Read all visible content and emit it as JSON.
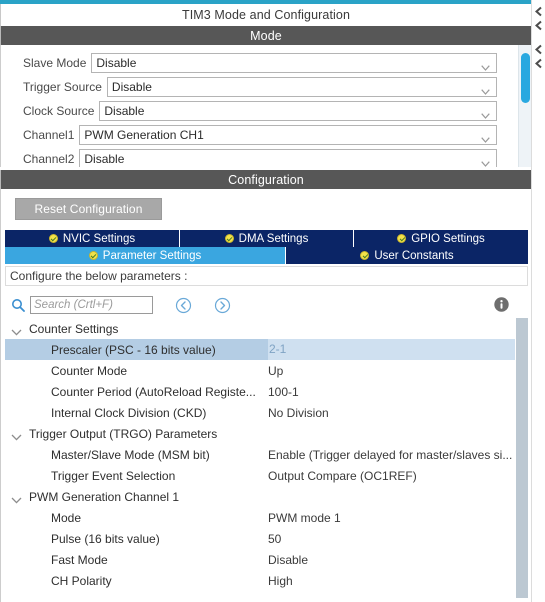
{
  "window": {
    "title": "TIM3 Mode and Configuration",
    "accent_color": "#2aa3c7"
  },
  "mode_section": {
    "band_title": "Mode",
    "fields": [
      {
        "label": "Slave Mode",
        "value": "Disable",
        "icon": "chevron-down-icon"
      },
      {
        "label": "Trigger Source",
        "value": "Disable",
        "icon": "chevron-down-icon"
      },
      {
        "label": "Clock Source",
        "value": "Disable",
        "icon": "chevron-down-icon"
      },
      {
        "label": "Channel1",
        "value": "PWM Generation CH1",
        "icon": "chevron-down-icon"
      },
      {
        "label": "Channel2",
        "value": "Disable",
        "icon": "chevron-down-icon"
      }
    ],
    "scrollbar": {
      "thumb_color": "#29a8e0",
      "track_color": "#eef3f7"
    }
  },
  "configuration_section": {
    "band_title": "Configuration",
    "reset_button": "Reset Configuration",
    "tabs_row1": [
      {
        "label": "NVIC Settings",
        "active": false,
        "icon": "check-badge-icon"
      },
      {
        "label": "DMA Settings",
        "active": false,
        "icon": "check-badge-icon"
      },
      {
        "label": "GPIO Settings",
        "active": false,
        "icon": "check-badge-icon"
      }
    ],
    "tabs_row2": [
      {
        "label": "Parameter Settings",
        "active": true,
        "icon": "check-badge-icon"
      },
      {
        "label": "User Constants",
        "active": false,
        "icon": "check-badge-icon"
      }
    ],
    "tab_colors": {
      "inactive_bg": "#0b2566",
      "active_bg": "#3aa6e0",
      "badge": "#f2e24a"
    },
    "configure_hint": "Configure the below parameters :",
    "search": {
      "placeholder": "Search (Crtl+F)",
      "value": "",
      "search_icon": "search-icon",
      "prev_icon": "circle-chevron-left-icon",
      "next_icon": "circle-chevron-right-icon",
      "info_icon": "info-icon"
    }
  },
  "parameter_tree": {
    "groups": [
      {
        "label": "Counter Settings",
        "expanded": true,
        "rows": [
          {
            "name": "Prescaler (PSC - 16 bits value)",
            "value": "2-1",
            "selected": true
          },
          {
            "name": "Counter Mode",
            "value": "Up",
            "selected": false
          },
          {
            "name": "Counter Period (AutoReload Registe...",
            "value": "100-1",
            "selected": false
          },
          {
            "name": "Internal Clock Division (CKD)",
            "value": "No Division",
            "selected": false
          }
        ]
      },
      {
        "label": "Trigger Output (TRGO) Parameters",
        "expanded": true,
        "rows": [
          {
            "name": "Master/Slave Mode (MSM bit)",
            "value": "Enable (Trigger delayed for master/slaves si...",
            "selected": false
          },
          {
            "name": "Trigger Event Selection",
            "value": "Output Compare (OC1REF)",
            "selected": false
          }
        ]
      },
      {
        "label": "PWM Generation Channel 1",
        "expanded": true,
        "rows": [
          {
            "name": "Mode",
            "value": "PWM mode 1",
            "selected": false
          },
          {
            "name": "Pulse (16 bits value)",
            "value": "50",
            "selected": false
          },
          {
            "name": "Fast Mode",
            "value": "Disable",
            "selected": false
          },
          {
            "name": "CH Polarity",
            "value": "High",
            "selected": false
          }
        ]
      }
    ]
  }
}
